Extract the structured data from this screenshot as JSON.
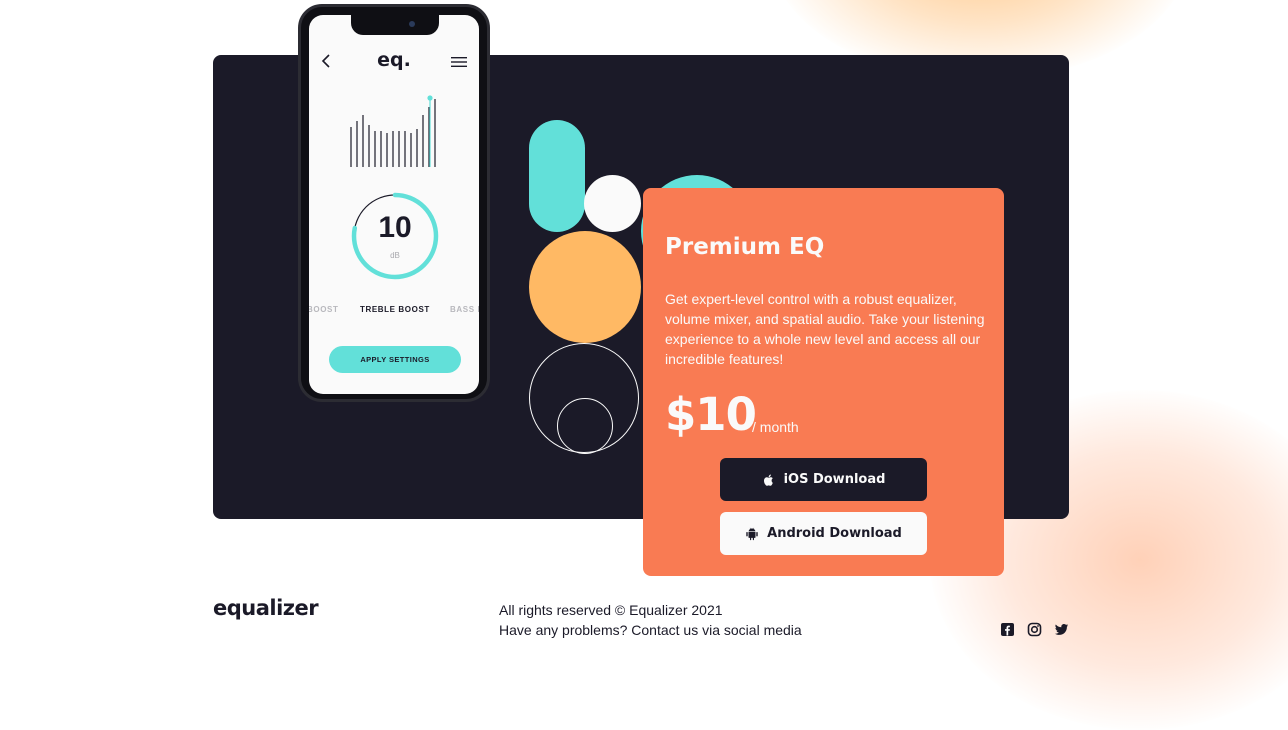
{
  "colors": {
    "dark": "#1b1a28",
    "teal": "#62e0d9",
    "orange": "#f97b53",
    "peach": "#ffb964",
    "light": "#fafafa"
  },
  "phone": {
    "logo": "eq.",
    "back_icon": "chevron-left-icon",
    "menu_icon": "hamburger-menu-icon",
    "dial_value": "10",
    "dial_unit": "dB",
    "dial_level_fraction": 0.78,
    "presets": {
      "previous": "BOOST",
      "current": "TREBLE BOOST",
      "next": "BASS B"
    },
    "apply_label": "APPLY SETTINGS"
  },
  "premium": {
    "title": "Premium EQ",
    "description": "Get expert-level control with a robust equalizer, volume mixer, and spatial audio. Take your listening experience to a whole new level and access all our incredible features!",
    "price": "$10",
    "period": "/ month",
    "ios_label": "iOS Download",
    "ios_icon": "apple-icon",
    "android_label": "Android Download",
    "android_icon": "android-icon"
  },
  "footer": {
    "logo": "equalizer",
    "copyright": "All rights reserved © Equalizer 2021",
    "contact": "Have any problems? Contact us via social media",
    "social": [
      "facebook-icon",
      "instagram-icon",
      "twitter-icon"
    ]
  }
}
